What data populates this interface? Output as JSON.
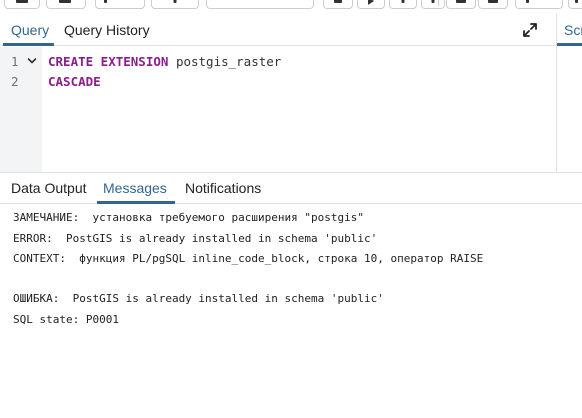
{
  "toolbar": {
    "buttons": [
      "save-icon",
      "save-dropdown-icon",
      "edit-icon",
      "filter-icon",
      "row-limit-select",
      "stop-icon",
      "execute-icon",
      "explain-icon",
      "explain-analyze-icon",
      "commit-icon",
      "rollback-icon",
      "macros-icon"
    ]
  },
  "query_panel": {
    "tabs": [
      {
        "label": "Query",
        "active": true
      },
      {
        "label": "Query History",
        "active": false
      }
    ],
    "right_panel_tab": "Scr",
    "accent_color": "#326690"
  },
  "editor": {
    "lines": [
      {
        "number": "1",
        "tokens": [
          {
            "text": "CREATE EXTENSION",
            "type": "keyword"
          },
          {
            "text": " postgis_raster",
            "type": "identifier"
          }
        ]
      },
      {
        "number": "2",
        "tokens": [
          {
            "text": "CASCADE",
            "type": "keyword"
          }
        ]
      }
    ],
    "keyword_color": "#8b1e8b"
  },
  "results_panel": {
    "tabs": [
      {
        "label": "Data Output",
        "active": false
      },
      {
        "label": "Messages",
        "active": true
      },
      {
        "label": "Notifications",
        "active": false
      }
    ],
    "messages": [
      "ЗАМЕЧАНИЕ:  установка требуемого расширения \"postgis\"",
      "ERROR:  PostGIS is already installed in schema 'public'",
      "CONTEXT:  функция PL/pgSQL inline_code_block, строка 10, оператор RAISE",
      "",
      "ОШИБКА:  PostGIS is already installed in schema 'public'",
      "SQL state: P0001"
    ]
  }
}
